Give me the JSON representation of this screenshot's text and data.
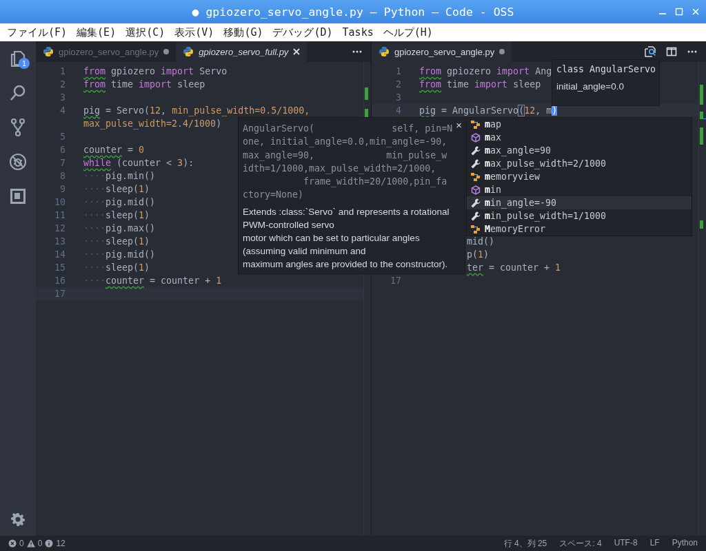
{
  "window": {
    "title": "● gpiozero_servo_angle.py — Python — Code - OSS"
  },
  "menu": [
    "ファイル(F)",
    "編集(E)",
    "選択(C)",
    "表示(V)",
    "移動(G)",
    "デバッグ(D)",
    "Tasks",
    "ヘルプ(H)"
  ],
  "activity_bar": [
    {
      "kind": "files",
      "badge": "1"
    },
    {
      "kind": "search"
    },
    {
      "kind": "scm"
    },
    {
      "kind": "debug"
    },
    {
      "kind": "extensions"
    }
  ],
  "editor_groups": [
    {
      "tabs": [
        {
          "label": "gpiozero_servo_angle.py",
          "selected": false,
          "dirty": true,
          "preview": false
        },
        {
          "label": "gpiozero_servo_full.py",
          "selected": true,
          "dirty": false,
          "preview": true
        }
      ],
      "actions": [
        {
          "kind": "more"
        }
      ],
      "lines": [
        {
          "n": "1",
          "tokens": [
            {
              "t": "from",
              "kind": "kw",
              "warn": true
            },
            {
              "t": " gpiozero ",
              "kind": "plain"
            },
            {
              "t": "import",
              "kind": "kw"
            },
            {
              "t": " Servo",
              "kind": "plain"
            }
          ]
        },
        {
          "n": "2",
          "tokens": [
            {
              "t": "from",
              "kind": "kw",
              "warn": true
            },
            {
              "t": " time ",
              "kind": "plain"
            },
            {
              "t": "import",
              "kind": "kw"
            },
            {
              "t": " sleep",
              "kind": "plain"
            }
          ]
        },
        {
          "n": "3"
        },
        {
          "n": "4",
          "tokens": [
            {
              "t": "pig",
              "kind": "plain",
              "warn": true
            },
            {
              "t": " = Servo(",
              "kind": "plain"
            },
            {
              "t": "12",
              "kind": "num"
            },
            {
              "t": ", ",
              "kind": "plain"
            },
            {
              "t": "min_pulse_width=0.5/1000,",
              "kind": "num"
            }
          ]
        },
        {
          "tokens": [
            {
              "t": "max_pulse_width=2.4/1000",
              "kind": "num"
            },
            {
              "t": ")",
              "kind": "plain"
            }
          ]
        },
        {
          "n": "5"
        },
        {
          "n": "6",
          "tokens": [
            {
              "t": "counter",
              "kind": "plain",
              "warn": true
            },
            {
              "t": " = ",
              "kind": "plain"
            },
            {
              "t": "0",
              "kind": "num"
            }
          ]
        },
        {
          "n": "7",
          "tokens": [
            {
              "t": "while",
              "kind": "kw",
              "warn": true
            },
            {
              "t": " (counter < ",
              "kind": "plain"
            },
            {
              "t": "3",
              "kind": "num"
            },
            {
              "t": "):",
              "kind": "plain"
            }
          ]
        },
        {
          "n": "8",
          "tokens": [
            {
              "t": "····",
              "kind": "ws"
            },
            {
              "t": "pig.min()",
              "kind": "plain"
            }
          ]
        },
        {
          "n": "9",
          "tokens": [
            {
              "t": "····",
              "kind": "ws"
            },
            {
              "t": "sleep(",
              "kind": "plain"
            },
            {
              "t": "1",
              "kind": "num"
            },
            {
              "t": ")",
              "kind": "plain"
            }
          ]
        },
        {
          "n": "10",
          "tokens": [
            {
              "t": "····",
              "kind": "ws"
            },
            {
              "t": "pig.mid()",
              "kind": "plain"
            }
          ]
        },
        {
          "n": "11",
          "tokens": [
            {
              "t": "····",
              "kind": "ws"
            },
            {
              "t": "sleep(",
              "kind": "plain"
            },
            {
              "t": "1",
              "kind": "num"
            },
            {
              "t": ")",
              "kind": "plain"
            }
          ]
        },
        {
          "n": "12",
          "tokens": [
            {
              "t": "····",
              "kind": "ws"
            },
            {
              "t": "pig.max()",
              "kind": "plain"
            }
          ]
        },
        {
          "n": "13",
          "tokens": [
            {
              "t": "····",
              "kind": "ws"
            },
            {
              "t": "sleep(",
              "kind": "plain"
            },
            {
              "t": "1",
              "kind": "num"
            },
            {
              "t": ")",
              "kind": "plain"
            }
          ]
        },
        {
          "n": "14",
          "tokens": [
            {
              "t": "····",
              "kind": "ws"
            },
            {
              "t": "pig.mid()",
              "kind": "plain"
            }
          ]
        },
        {
          "n": "15",
          "tokens": [
            {
              "t": "····",
              "kind": "ws"
            },
            {
              "t": "sleep(",
              "kind": "plain"
            },
            {
              "t": "1",
              "kind": "num"
            },
            {
              "t": ")",
              "kind": "plain"
            }
          ]
        },
        {
          "n": "16",
          "tokens": [
            {
              "t": "····",
              "kind": "ws"
            },
            {
              "t": "counter",
              "kind": "plain",
              "warn": true
            },
            {
              "t": " = counter + ",
              "kind": "plain"
            },
            {
              "t": "1",
              "kind": "num"
            }
          ]
        },
        {
          "n": "17",
          "current": true
        }
      ]
    },
    {
      "tabs": [
        {
          "label": "gpiozero_servo_angle.py",
          "selected": true,
          "dirty": true,
          "preview": false
        }
      ],
      "actions": [
        {
          "kind": "find-in-file"
        },
        {
          "kind": "split"
        },
        {
          "kind": "more"
        }
      ],
      "lines": [
        {
          "n": "1",
          "tokens": [
            {
              "t": "from",
              "kind": "kw",
              "warn": true
            },
            {
              "t": " gpiozero ",
              "kind": "plain"
            },
            {
              "t": "import",
              "kind": "kw"
            },
            {
              "t": " Ang",
              "kind": "plain"
            }
          ]
        },
        {
          "n": "2",
          "tokens": [
            {
              "t": "from",
              "kind": "kw",
              "warn": true
            },
            {
              "t": " time ",
              "kind": "plain"
            },
            {
              "t": "import",
              "kind": "kw"
            },
            {
              "t": " sleep",
              "kind": "plain"
            }
          ]
        },
        {
          "n": "3"
        },
        {
          "n": "4",
          "tokens": [
            {
              "t": "pig",
              "kind": "plain",
              "warn": true
            },
            {
              "t": " = AngularServo",
              "kind": "plain"
            },
            {
              "t": "(",
              "kind": "bracket"
            },
            {
              "t": "12",
              "kind": "num"
            },
            {
              "t": ", m",
              "kind": "plain"
            },
            {
              "t": ")",
              "kind": "cursor"
            }
          ],
          "current": true
        },
        {
          "kind": "hidden"
        },
        {
          "kind": "hidden"
        },
        {
          "kind": "hidden"
        },
        {
          "kind": "hidden"
        },
        {
          "kind": "hidden"
        },
        {
          "kind": "hidden"
        },
        {
          "kind": "hidden"
        },
        {
          "kind": "hidden"
        },
        {
          "kind": "hidden"
        },
        {
          "kind": "cut",
          "tokens": [
            {
              "t": "mid()",
              "kind": "plain"
            }
          ]
        },
        {
          "kind": "cut",
          "tokens": [
            {
              "t": "p(",
              "kind": "plain"
            },
            {
              "t": "1",
              "kind": "num"
            },
            {
              "t": ")",
              "kind": "plain"
            }
          ]
        },
        {
          "kind": "cut",
          "tokens": [
            {
              "t": "ter",
              "kind": "plain",
              "warn": true
            },
            {
              "t": " = counter + ",
              "kind": "plain"
            },
            {
              "t": "1",
              "kind": "num"
            }
          ]
        },
        {
          "n": "17"
        }
      ]
    }
  ],
  "hover": {
    "signature": [
      "AngularServo(              self, pin=N",
      "one, initial_angle=0.0,min_angle=-90,",
      "max_angle=90,             min_pulse_w",
      "idth=1/1000,max_pulse_width=2/1000,",
      "           frame_width=20/1000,pin_fa",
      "ctory=None)"
    ],
    "description": [
      "Extends :class:`Servo` and represents a rotational",
      "PWM-controlled servo",
      "motor which can be set to particular angles",
      "(assuming valid minimum and",
      "maximum angles are provided to the constructor)."
    ],
    "close": "×"
  },
  "suggestions": [
    {
      "kind": "class",
      "label": "**m**ap",
      "selected": false
    },
    {
      "kind": "method",
      "label": "**m**ax",
      "selected": false
    },
    {
      "kind": "property",
      "label": "**m**ax_angle=90",
      "selected": false
    },
    {
      "kind": "property",
      "label": "**m**ax_pulse_width=2/1000",
      "selected": false
    },
    {
      "kind": "class",
      "label": "**m**emoryview",
      "selected": false
    },
    {
      "kind": "method",
      "label": "**m**in",
      "selected": false
    },
    {
      "kind": "property",
      "label": "**m**in_angle=-90",
      "selected": true
    },
    {
      "kind": "property",
      "label": "**m**in_pulse_width=1/1000",
      "selected": false
    },
    {
      "kind": "class",
      "label": "**M**emoryError",
      "selected": false
    }
  ],
  "parameter_hint": {
    "title": "class AngularServo",
    "param": "initial_angle=0.0"
  },
  "status_bar": {
    "errors": "0",
    "warnings": "0",
    "infos": "12",
    "items": [
      "行 4、列 25",
      "スペース: 4",
      "UTF-8",
      "LF",
      "Python"
    ]
  }
}
